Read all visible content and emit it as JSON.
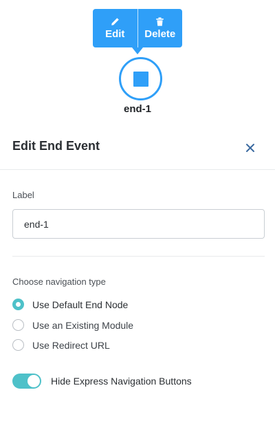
{
  "toolbar": {
    "edit_label": "Edit",
    "edit_icon": "pencil-icon",
    "delete_label": "Delete",
    "delete_icon": "trash-icon",
    "color": "#2f9ff8"
  },
  "node": {
    "label": "end-1",
    "icon": "stop-square-icon"
  },
  "panel": {
    "title": "Edit End Event",
    "close_icon": "close-icon",
    "label_field": {
      "label": "Label",
      "value": "end-1"
    },
    "navigation": {
      "title": "Choose navigation type",
      "options": [
        {
          "label": "Use Default End Node",
          "selected": true
        },
        {
          "label": "Use an Existing Module",
          "selected": false
        },
        {
          "label": "Use Redirect URL",
          "selected": false
        }
      ]
    },
    "toggle": {
      "label": "Hide Express Navigation Buttons",
      "on": true
    },
    "accent_color": "#4ec1c9"
  }
}
